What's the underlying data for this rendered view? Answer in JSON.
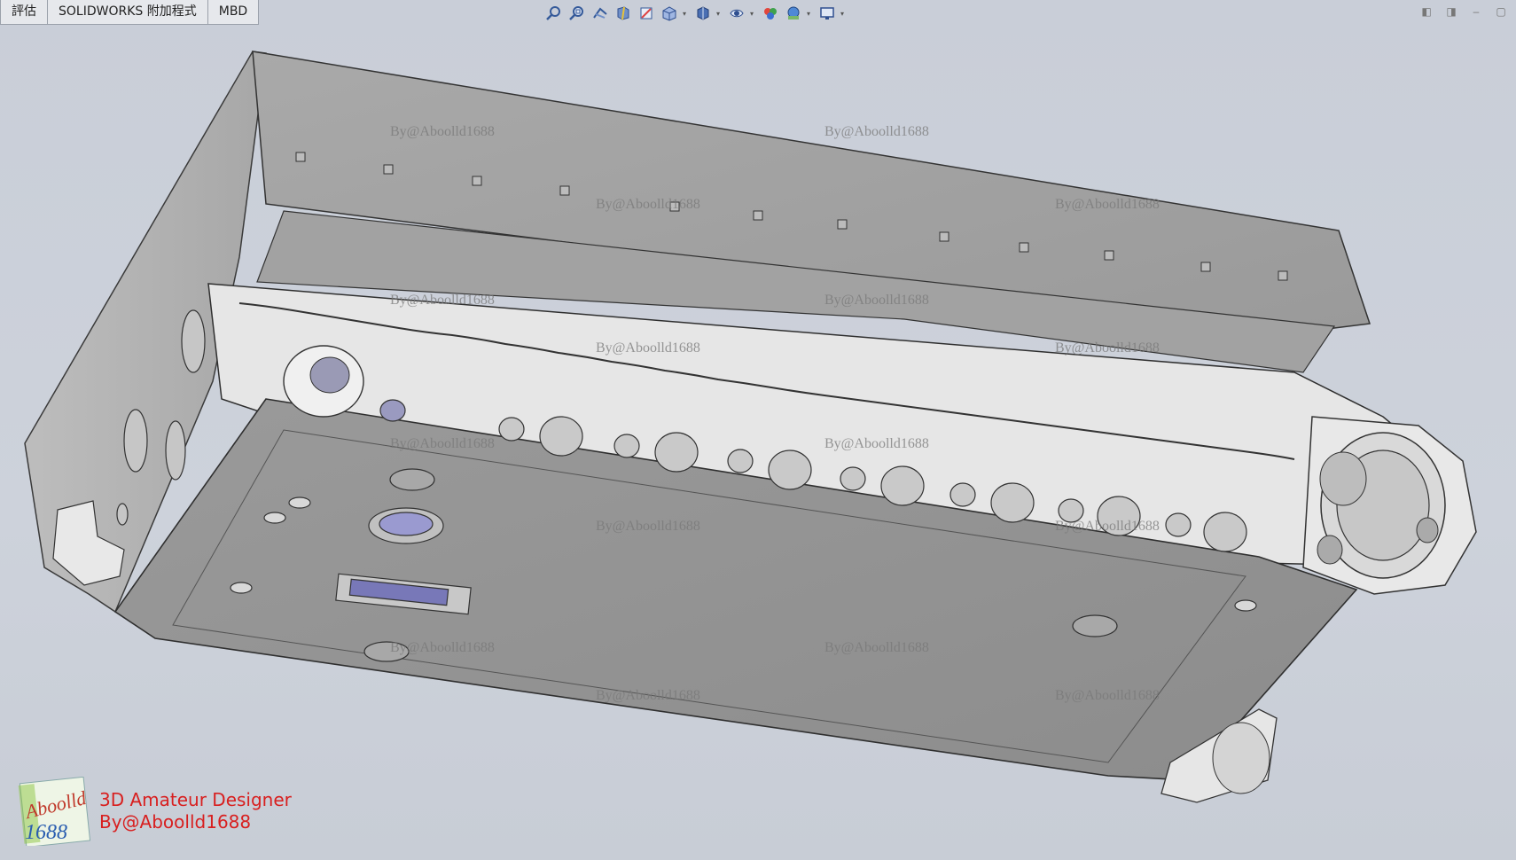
{
  "tabs": [
    {
      "label": "評估"
    },
    {
      "label": "SOLIDWORKS 附加程式"
    },
    {
      "label": "MBD"
    }
  ],
  "toolbar": {
    "icons": [
      "zoom-to-fit-icon",
      "zoom-area-icon",
      "previous-view-icon",
      "section-view-icon",
      "dynamic-annotation-icon",
      "view-orientation-icon",
      "display-style-icon",
      "hide-show-items-icon",
      "edit-appearance-icon",
      "apply-scene-icon",
      "view-settings-icon"
    ]
  },
  "watermark": "By@Aboolld1688",
  "branding": {
    "line1": "3D Amateur Designer",
    "line2": "By@Aboolld1688",
    "logo_top": "Aboolld",
    "logo_bottom": "1688"
  },
  "colors": {
    "background": "#cbd0d9",
    "panel_gray": "#9c9c9c",
    "rail_light": "#e4e4e4",
    "brand_red": "#d81f1f"
  }
}
